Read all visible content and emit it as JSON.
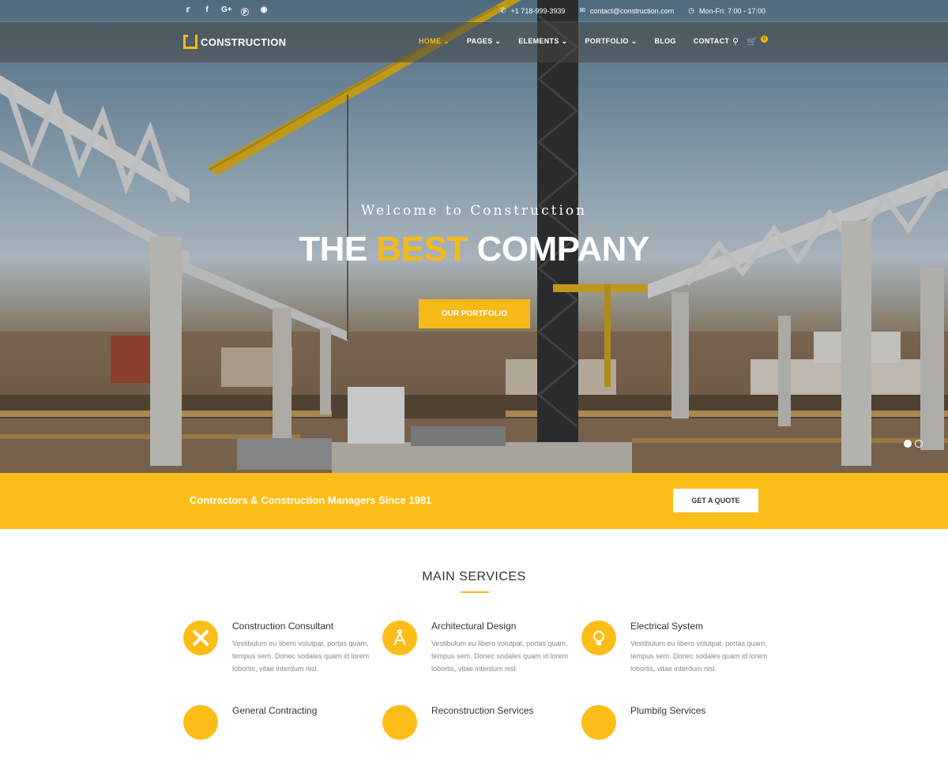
{
  "topbar": {
    "social": [
      "twitter-icon",
      "facebook-icon",
      "google-plus-icon",
      "pinterest-icon",
      "dribbble-icon"
    ],
    "phone": "+1 718-999-3939",
    "email": "contact@construction.com",
    "hours": "Mon-Fri: 7:00 - 17:00"
  },
  "nav": {
    "logo": "CONSTRUCTION",
    "items": [
      {
        "label": "HOME",
        "dropdown": true,
        "active": true
      },
      {
        "label": "PAGES",
        "dropdown": true
      },
      {
        "label": "ELEMENTS",
        "dropdown": true
      },
      {
        "label": "PORTFOLIO",
        "dropdown": true
      },
      {
        "label": "BLOG"
      },
      {
        "label": "CONTACT"
      }
    ],
    "cart_count": "0"
  },
  "hero": {
    "subtitle": "Welcome to Construction",
    "title_part1": "THE",
    "title_accent": "BEST",
    "title_part2": "COMPANY",
    "button": "OUR PORTFOLIO",
    "slides": 2,
    "active_slide": 1
  },
  "band": {
    "text": "Contractors & Construction Managers Since 1981",
    "button": "GET A QUOTE"
  },
  "services": {
    "heading": "MAIN SERVICES",
    "items": [
      {
        "title": "Construction Consultant",
        "icon": "tools-icon",
        "desc": "Vestibulum eu libero volutpat, portas quam, tempus sem. Donec sodales quam id lorem lobortis, vitae interdum nisl."
      },
      {
        "title": "Architectural Design",
        "icon": "compass-icon",
        "desc": "Vestibulum eu libero volutpat, portas quam, tempus sem. Donec sodales quam id lorem lobortis, vitae interdum nisl."
      },
      {
        "title": "Electrical System",
        "icon": "lightbulb-icon",
        "desc": "Vestibulum eu libero volutpat, portas quam, tempus sem. Donec sodales quam id lorem lobortis, vitae interdum nisl."
      },
      {
        "title": "General Contracting",
        "icon": "helmet-icon",
        "desc": ""
      },
      {
        "title": "Reconstruction Services",
        "icon": "wrench-icon",
        "desc": ""
      },
      {
        "title": "Plumbilg Services",
        "icon": "pipe-icon",
        "desc": ""
      }
    ]
  },
  "colors": {
    "accent": "#fdbd18",
    "text": "#333333",
    "muted": "#888888"
  }
}
